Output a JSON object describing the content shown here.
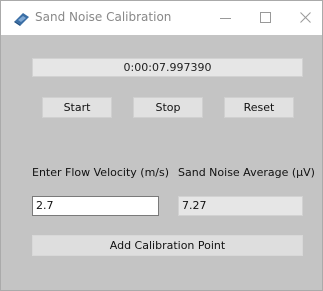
{
  "window": {
    "title": "Sand Noise Calibration",
    "controls": {
      "minimize": "minimize-icon",
      "maximize": "maximize-icon",
      "close": "close-icon"
    }
  },
  "timer": {
    "value": "0:00:07.997390"
  },
  "buttons": {
    "start": "Start",
    "stop": "Stop",
    "reset": "Reset",
    "add_point": "Add Calibration Point"
  },
  "fields": {
    "velocity_label": "Enter Flow Velocity (m/s)",
    "velocity_value": "2.7",
    "noise_label": "Sand Noise Average (μV)",
    "noise_value": "7.27"
  },
  "colors": {
    "client_background": "#c4c4c4",
    "button_face": "#e1e1e1",
    "title_text": "#888888"
  }
}
